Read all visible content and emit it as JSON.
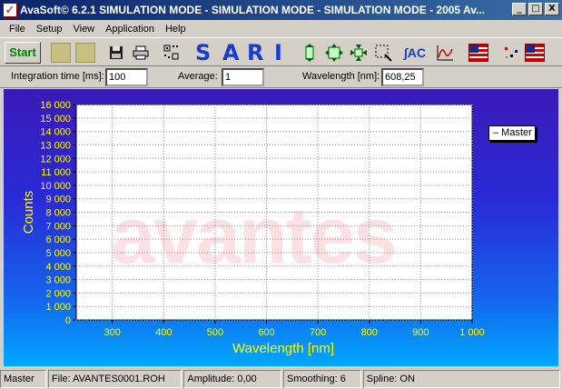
{
  "window": {
    "title": "AvaSoft© 6.2.1 SIMULATION MODE - SIMULATION MODE - SIMULATION MODE - 2005 Av...",
    "minimize": "_",
    "maximize": "□",
    "close": "X"
  },
  "menu": [
    "File",
    "Setup",
    "View",
    "Application",
    "Help"
  ],
  "toolbar": {
    "start_label": "Start",
    "sari_letters": [
      "S",
      "A",
      "R",
      "I"
    ],
    "icons": [
      "save-icon",
      "print-icon",
      "scope-mode-icon",
      "zoom-vertical-icon",
      "zoom-all-icon",
      "zoom-in-icon",
      "zoom-area-icon",
      "auto-scale-icon",
      "chart-icon",
      "flag-hcf-icon",
      "points-icon",
      "flag-eurx-icon"
    ],
    "sac_label": "∫AC"
  },
  "params": {
    "integration_label": "Integration time [ms]:",
    "integration_value": "100",
    "average_label": "Average:",
    "average_value": "1",
    "wavelength_label": "Wavelength [nm]:",
    "wavelength_value": "608,25"
  },
  "watermark": "avantes",
  "chart_data": {
    "type": "line",
    "xlabel": "Wavelength [nm]",
    "ylabel": "Counts",
    "xlim": [
      230,
      1000
    ],
    "ylim": [
      0,
      16000
    ],
    "xticks": [
      300,
      400,
      500,
      600,
      700,
      800,
      900,
      1000
    ],
    "xtick_labels": [
      "300",
      "400",
      "500",
      "600",
      "700",
      "800",
      "900",
      "1 000"
    ],
    "yticks": [
      0,
      1000,
      2000,
      3000,
      4000,
      5000,
      6000,
      7000,
      8000,
      9000,
      10000,
      11000,
      12000,
      13000,
      14000,
      15000,
      16000
    ],
    "ytick_labels": [
      "0",
      "1 000",
      "2 000",
      "3 000",
      "4 000",
      "5 000",
      "6 000",
      "7 000",
      "8 000",
      "9 000",
      "10 000",
      "11 000",
      "12 000",
      "13 000",
      "14 000",
      "15 000",
      "16 000"
    ],
    "grid": true,
    "legend": "top-right",
    "series": [
      {
        "name": "Master",
        "x": [],
        "y": []
      }
    ],
    "tick_color": "#ffff00"
  },
  "legend_label": "– Master",
  "status": {
    "spectrum": "Master",
    "file": "File: AVANTES0001.ROH",
    "amplitude": "Amplitude: 0,00",
    "smoothing": "Smoothing: 6",
    "spline": "Spline: ON"
  }
}
